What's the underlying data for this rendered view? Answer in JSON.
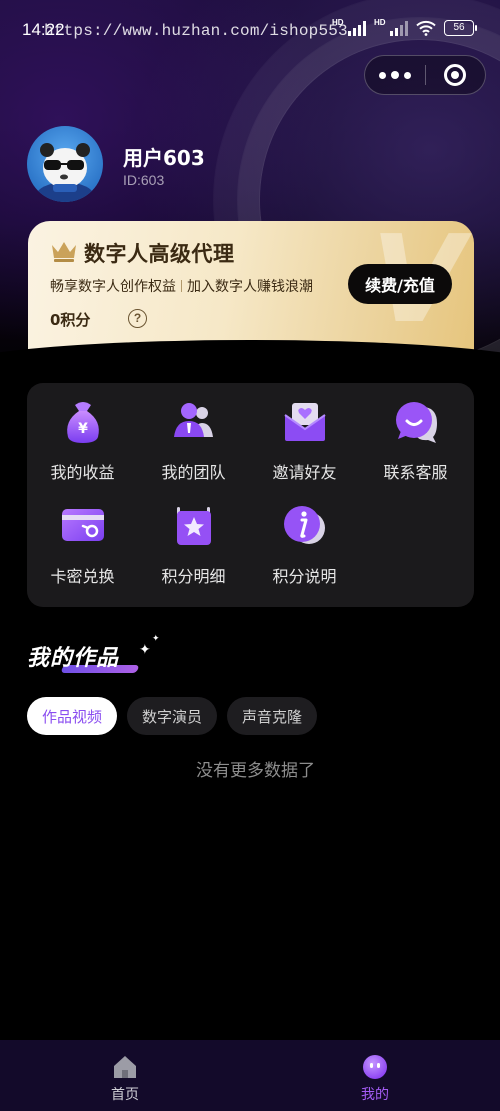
{
  "status_bar": {
    "time": "14:22",
    "url": "https://www.huzhan.com/ishop553",
    "battery": "56",
    "signal_label_1": "HD",
    "signal_label_2": "HD"
  },
  "profile": {
    "username": "用户603",
    "user_id": "ID:603"
  },
  "vip_card": {
    "title": "数字人高级代理",
    "desc_left": "畅享数字人创作权益",
    "desc_right": "加入数字人赚钱浪潮",
    "button": "续费/充值",
    "points": "0积分",
    "help": "?",
    "watermark": "V",
    "colors": {
      "gold_light": "#fbf3e2",
      "gold_dark": "#e6c57d",
      "text": "#3b2a13"
    }
  },
  "menu": {
    "items": [
      {
        "label": "我的收益",
        "icon": "money-bag-icon"
      },
      {
        "label": "我的团队",
        "icon": "team-icon"
      },
      {
        "label": "邀请好友",
        "icon": "envelope-invite-icon"
      },
      {
        "label": "联系客服",
        "icon": "chat-bubble-icon"
      },
      {
        "label": "卡密兑换",
        "icon": "card-exchange-icon"
      },
      {
        "label": "积分明细",
        "icon": "calendar-star-icon"
      },
      {
        "label": "积分说明",
        "icon": "info-icon"
      }
    ]
  },
  "works": {
    "title": "我的作品",
    "tabs": [
      {
        "label": "作品视频",
        "active": true
      },
      {
        "label": "数字演员",
        "active": false
      },
      {
        "label": "声音克隆",
        "active": false
      }
    ],
    "empty_text": "没有更多数据了"
  },
  "tabbar": {
    "items": [
      {
        "label": "首页",
        "icon": "home-icon",
        "active": false
      },
      {
        "label": "我的",
        "icon": "profile-face-icon",
        "active": true
      }
    ],
    "colors": {
      "active": "#a45cf5",
      "inactive": "#cfcfd6"
    }
  },
  "theme": {
    "accent": "#8a4df0",
    "background": "#000000",
    "card": "#1b1a1c"
  }
}
